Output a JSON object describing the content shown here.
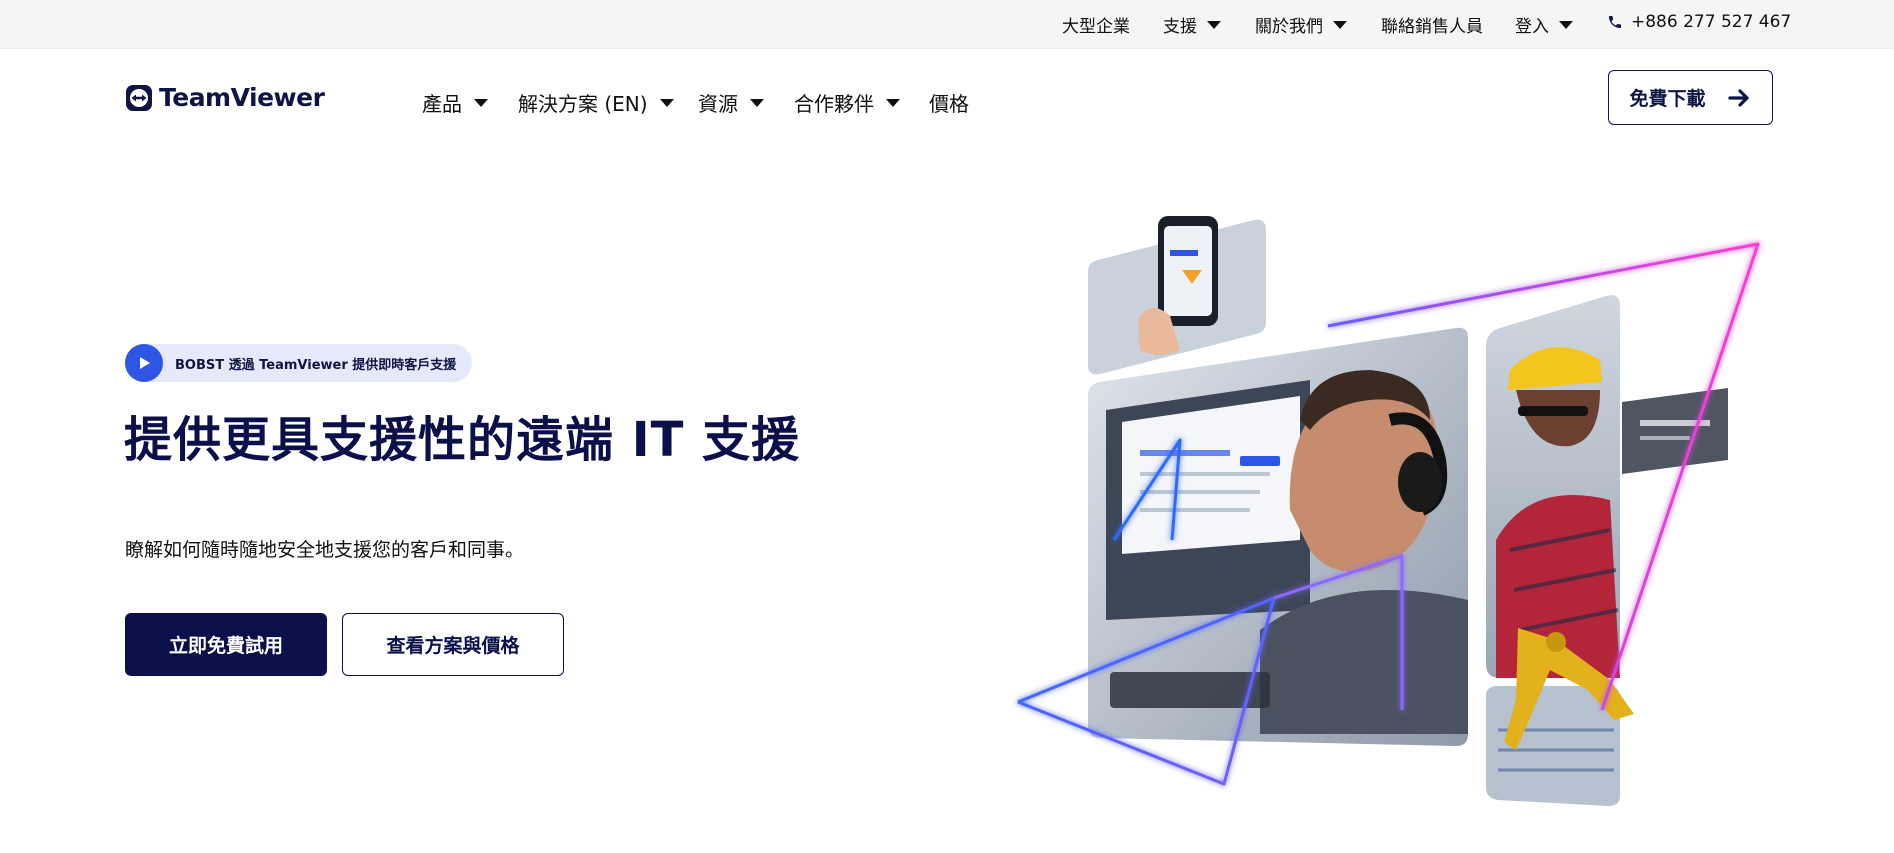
{
  "utility_bar": {
    "enterprise": "大型企業",
    "support": "支援",
    "about": "關於我們",
    "contact_sales": "聯絡銷售人員",
    "login": "登入",
    "phone": "+886 277 527 467"
  },
  "nav": {
    "logo_text": "TeamViewer",
    "items": [
      {
        "label": "產品"
      },
      {
        "label": "解決方案 (EN)"
      },
      {
        "label": "資源"
      },
      {
        "label": "合作夥伴"
      },
      {
        "label": "價格"
      }
    ],
    "download_label": "免費下載"
  },
  "hero": {
    "badge_text": "BOBST 透過 TeamViewer 提供即時客戶支援",
    "title": "提供更具支援性的遠端 IT 支援",
    "subtitle": "瞭解如何隨時隨地安全地支援您的客戶和同事。",
    "primary_cta": "立即免費試用",
    "secondary_cta": "查看方案與價格"
  },
  "colors": {
    "brand_navy": "#0b0f4a",
    "accent_blue": "#2f55e6",
    "badge_bg": "#e6e9fb",
    "utility_bg": "#f5f5f5"
  }
}
